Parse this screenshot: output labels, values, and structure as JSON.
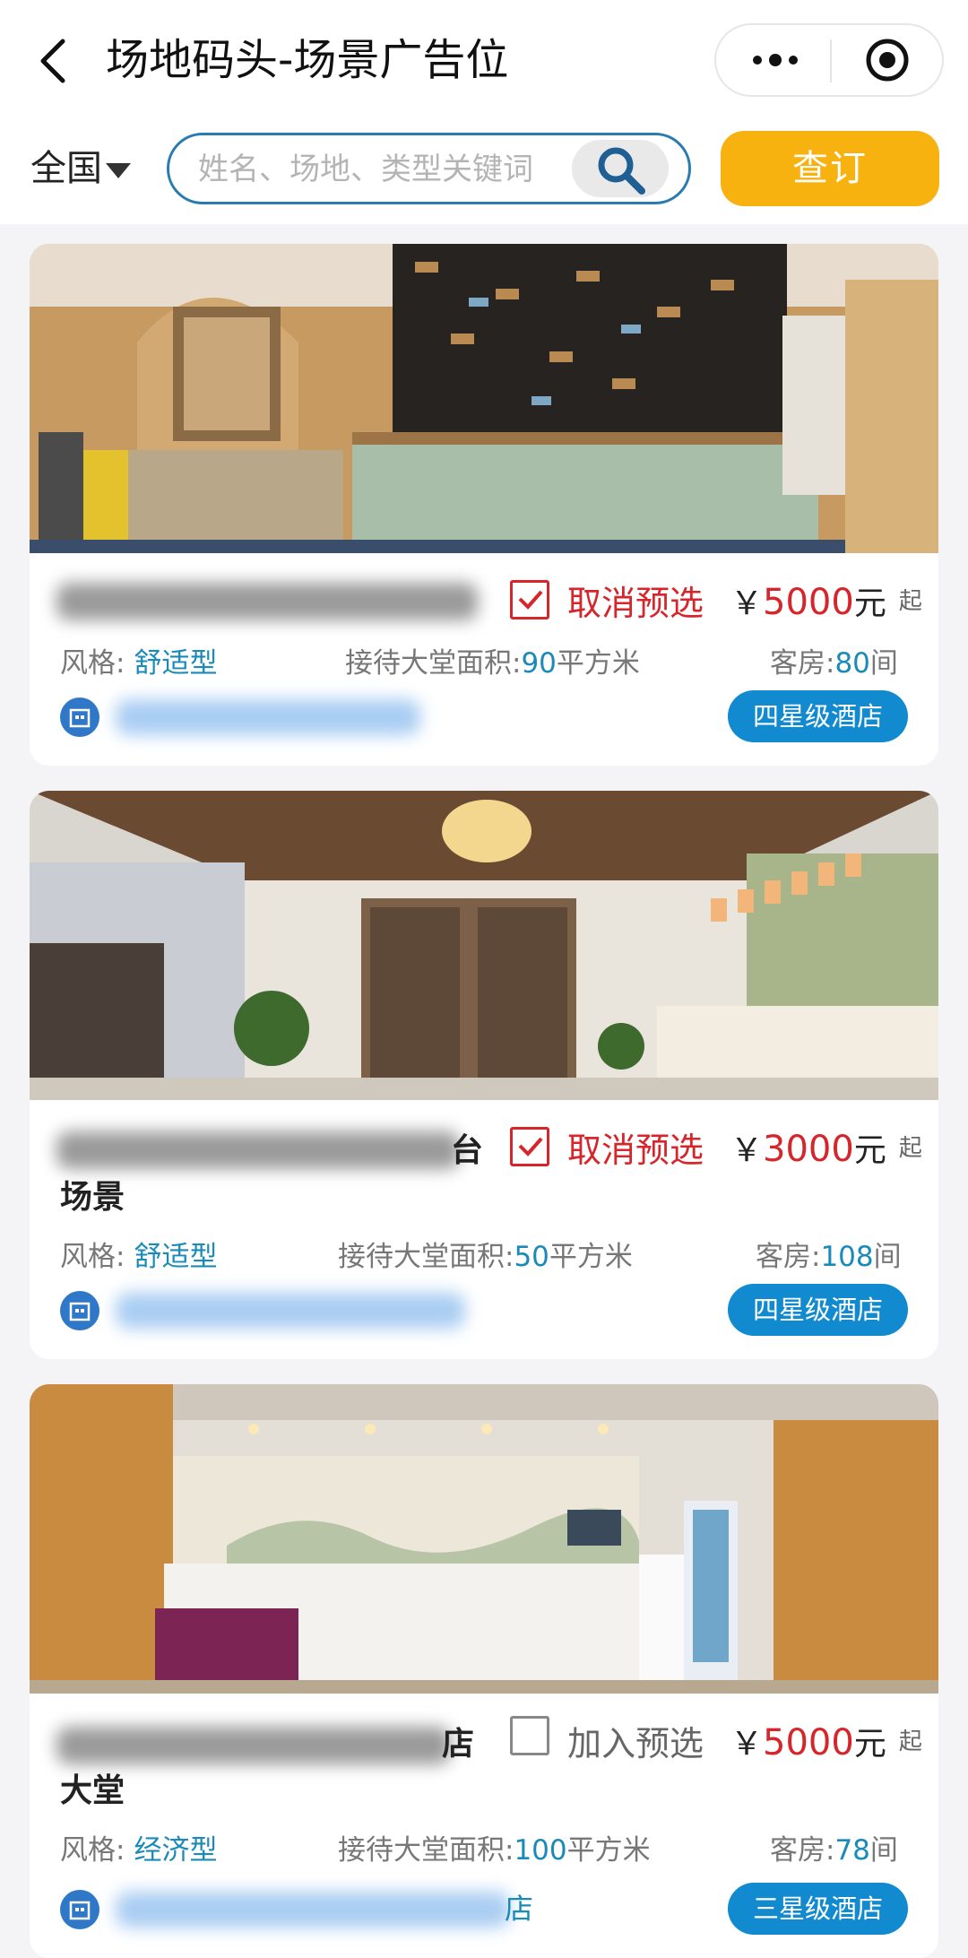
{
  "header": {
    "title": "场地码头-场景广告位",
    "region": "全国",
    "search_placeholder": "姓名、场地、类型关键词",
    "book_label": "查订"
  },
  "icons": {
    "back": "chevron-left-icon",
    "more": "more-dots-icon",
    "close": "target-close-icon",
    "search": "search-icon",
    "caret": "caret-down-icon",
    "hotel": "hotel-icon",
    "check": "checkmark-icon"
  },
  "colors": {
    "accent_blue": "#1a8ab8",
    "book_orange": "#f7b20f",
    "price_red": "#d6252b",
    "badge_blue": "#128ad0"
  },
  "venues": [
    {
      "name_tail": "",
      "name_line2": "",
      "selected": true,
      "select_label": "取消预选",
      "currency": "￥",
      "price": "5000",
      "price_unit": "元",
      "price_from": "起",
      "style_label": "风格:",
      "style_value": "舒适型",
      "lobby_label": "接待大堂面积:",
      "lobby_value": "90",
      "lobby_unit": "平方米",
      "rooms_label": "客房:",
      "rooms_value": "80",
      "rooms_unit": "间",
      "hotel_name_tail": "",
      "grade": "四星级酒店"
    },
    {
      "name_tail": "台",
      "name_line2": "场景",
      "selected": true,
      "select_label": "取消预选",
      "currency": "￥",
      "price": "3000",
      "price_unit": "元",
      "price_from": "起",
      "style_label": "风格:",
      "style_value": "舒适型",
      "lobby_label": "接待大堂面积:",
      "lobby_value": "50",
      "lobby_unit": "平方米",
      "rooms_label": "客房:",
      "rooms_value": "108",
      "rooms_unit": "间",
      "hotel_name_tail": "",
      "grade": "四星级酒店"
    },
    {
      "name_tail": "店",
      "name_line2": "大堂",
      "selected": false,
      "select_label": "加入预选",
      "currency": "￥",
      "price": "5000",
      "price_unit": "元",
      "price_from": "起",
      "style_label": "风格:",
      "style_value": "经济型",
      "lobby_label": "接待大堂面积:",
      "lobby_value": "100",
      "lobby_unit": "平方米",
      "rooms_label": "客房:",
      "rooms_value": "78",
      "rooms_unit": "间",
      "hotel_name_tail": "店",
      "grade": "三星级酒店"
    }
  ]
}
